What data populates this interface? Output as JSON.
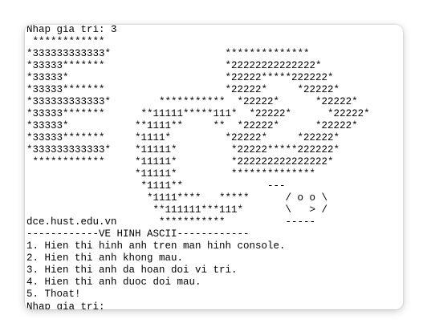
{
  "console": {
    "lines": [
      "Nhap gia tri: 3",
      " ************                   ",
      "*333333333333*                   **************",
      "*33333*******                    *22222222222222*",
      "*33333*                          *22222*****222222*",
      "*33333*******                    *22222*     *22222*",
      "*333333333333*        ***********  *22222*      *22222*",
      "*33333*******      **11111*****111*  *22222*      *22222*",
      "*33333*           **1111**     **  *22222*      *22222*",
      "*33333*******     *1111*         *22222*     *22222*",
      "*333333333333*    *11111*         *22222*****222222*",
      " ************     *11111*         *222222222222222*",
      "                  *11111*         **************",
      "                   *1111**              ---",
      "                    *1111****   *****      / o o \\",
      "                     **111111***111*       \\   > /",
      "dce.hust.edu.vn       ***********          -----",
      "------------VE HINH ASCII------------",
      "1. Hien thi hinh anh tren man hinh console.",
      "2. Hien thi anh khong mau.",
      "3. Hien thi anh da hoan doi vi tri.",
      "4. Hien thi anh duoc doi mau.",
      "5. Thoat!",
      "Nhap gia tri: "
    ]
  }
}
